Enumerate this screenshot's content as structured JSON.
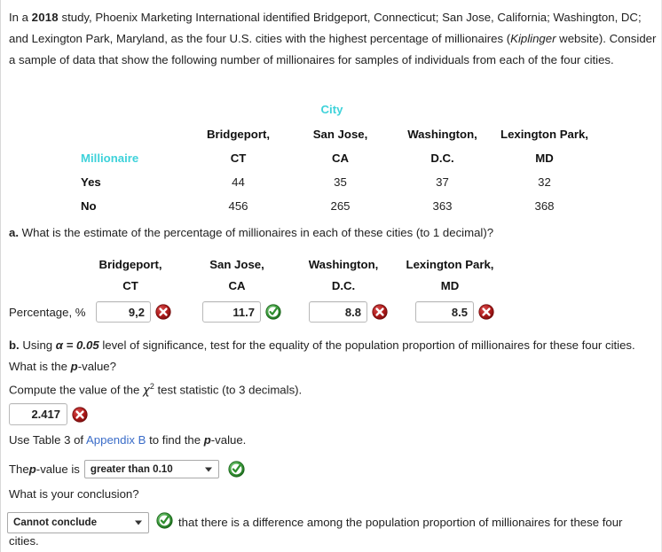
{
  "intro": {
    "before_year": "In a ",
    "year": "2018",
    "line1_rest": " study, Phoenix Marketing International identified Bridgeport, Connecticut; San Jose, California; Washington, DC; and Lexington Park, Maryland, as the four U.S. cities with the highest percentage of millionaires (",
    "source_italic": "Kiplinger",
    "line1_end": " website). Consider a sample of data that show the following number of millionaires for samples of individuals from each of the four cities."
  },
  "colors": {
    "accent_teal": "#3ed2da",
    "link_blue": "#3a6cc8",
    "correct_green": "#2f8f2f",
    "incorrect_red": "#9e1b1b",
    "text": "#222222"
  },
  "table": {
    "group_header": "City",
    "row_label_header": "Millionaire",
    "columns": [
      {
        "city": "Bridgeport,",
        "state": "CT"
      },
      {
        "city": "San Jose,",
        "state": "CA"
      },
      {
        "city": "Washington,",
        "state": "D.C."
      },
      {
        "city": "Lexington Park,",
        "state": "MD"
      }
    ],
    "rows": [
      {
        "label": "Yes",
        "values": [
          "44",
          "35",
          "37",
          "32"
        ]
      },
      {
        "label": "No",
        "values": [
          "456",
          "265",
          "363",
          "368"
        ]
      }
    ]
  },
  "part_a": {
    "prefix": "a.",
    "question": " What is the estimate of the percentage of millionaires in each of these cities (to 1 decimal)?",
    "columns": [
      {
        "city": "Bridgeport,",
        "state": "CT"
      },
      {
        "city": "San Jose,",
        "state": "CA"
      },
      {
        "city": "Washington,",
        "state": "D.C."
      },
      {
        "city": "Lexington Park,",
        "state": "MD"
      }
    ],
    "row_label": "Percentage, %",
    "answers": [
      {
        "value": "9,2",
        "status": "incorrect",
        "icon": "error-circle-icon"
      },
      {
        "value": "11.7",
        "status": "correct",
        "icon": "check-circle-icon"
      },
      {
        "value": "8.8",
        "status": "incorrect",
        "icon": "error-circle-icon"
      },
      {
        "value": "8.5",
        "status": "incorrect",
        "icon": "error-circle-icon"
      }
    ]
  },
  "part_b": {
    "prefix": "b.",
    "q_part1": " Using ",
    "alpha": "α = 0.05",
    "q_part2": " level of significance, test for the equality of the population proportion of millionaires for these four cities. What is the ",
    "p_italic": "p",
    "q_part3": "-value?",
    "compute_prefix": "Compute the value of the ",
    "chi_symbol": "χ",
    "chi_exponent": "2",
    "compute_suffix": " test statistic (to 3 decimals).",
    "chi_value": "2.417",
    "chi_status": "incorrect",
    "chi_icon": "error-circle-icon",
    "use_table_prefix": "Use Table 3 of ",
    "appendix_link": "Appendix B",
    "use_table_suffix": " to find the ",
    "use_table_p": "p",
    "use_table_end": "-value.",
    "pvalue_label_prefix": "The ",
    "pvalue_label_p": "p",
    "pvalue_label_suffix": "-value is",
    "pvalue_selected": "greater than 0.10",
    "pvalue_status": "correct",
    "pvalue_icon": "check-circle-icon",
    "conclusion_question": "What is your conclusion?",
    "conclusion_selected": "Cannot conclude",
    "conclusion_status": "correct",
    "conclusion_icon": "check-circle-icon",
    "conclusion_tail": "that there is a difference among the population proportion of millionaires for these four",
    "conclusion_tail2": "cities."
  }
}
